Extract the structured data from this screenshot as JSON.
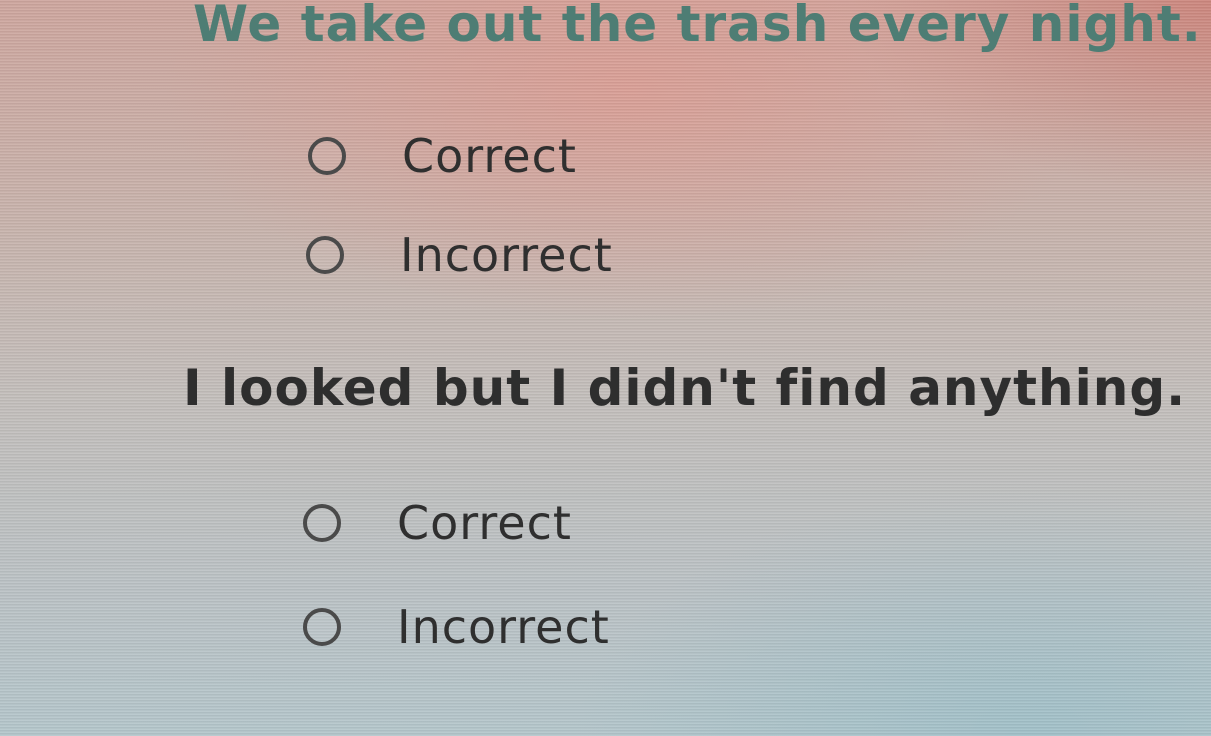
{
  "questions": [
    {
      "text": "We take out the trash every night.",
      "options": [
        "Correct",
        "Incorrect"
      ]
    },
    {
      "text": "I looked but I didn't find anything.",
      "options": [
        "Correct",
        "Incorrect"
      ]
    }
  ],
  "colors": {
    "first_question_text": "#4e7d74",
    "second_question_text": "#2e2e2e"
  }
}
